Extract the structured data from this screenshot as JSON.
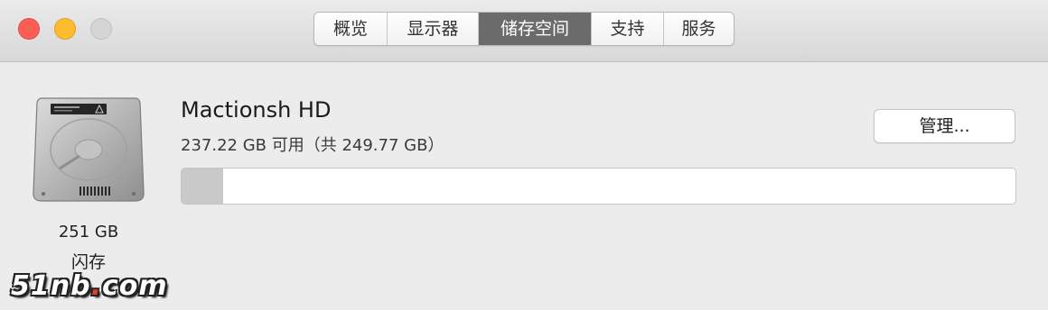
{
  "tabs": [
    {
      "label": "概览"
    },
    {
      "label": "显示器"
    },
    {
      "label": "储存空间",
      "active": true
    },
    {
      "label": "支持"
    },
    {
      "label": "服务"
    }
  ],
  "drive": {
    "icon": "hard-drive-icon",
    "size": "251 GB",
    "type": "闪存"
  },
  "volume": {
    "name": "Mactionsh HD",
    "capacity": "237.22 GB 可用（共 249.77 GB）",
    "used_fraction": 0.05
  },
  "manage_label": "管理...",
  "watermark": {
    "prefix": "51nb",
    "dot": ".",
    "suffix": "com"
  },
  "colors": {
    "active_tab": "#6b6b6b",
    "close": "#fc5f57",
    "minimize": "#fdbc2e",
    "zoom": "#d5d5d5",
    "used_segment": "#c9c9c9"
  }
}
